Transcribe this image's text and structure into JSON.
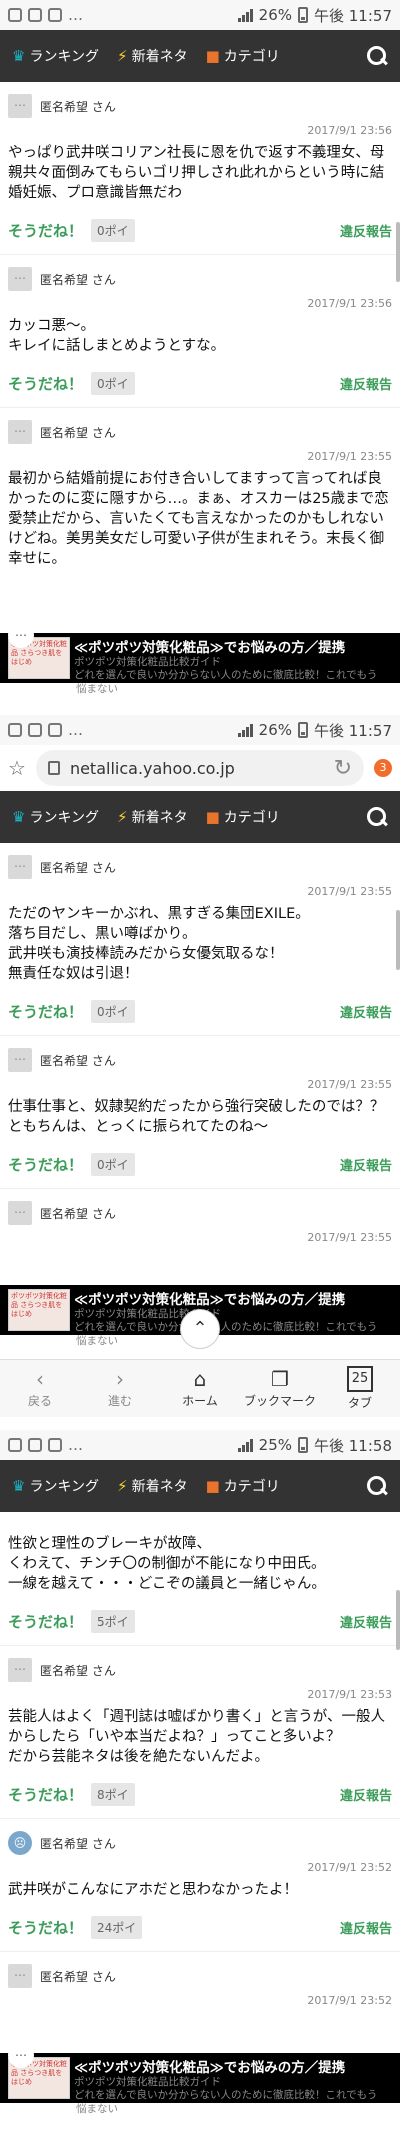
{
  "status": [
    {
      "battery": "26%",
      "time": "午後 11:57"
    },
    {
      "battery": "26%",
      "time": "午後 11:57"
    },
    {
      "battery": "25%",
      "time": "午後 11:58"
    }
  ],
  "nav": {
    "ranking": "ランキング",
    "news": "新着ネタ",
    "category": "カテゴリ"
  },
  "common": {
    "author": "匿名希望 さん",
    "agree": "そうだね！",
    "report": "違反報告"
  },
  "ad": {
    "title": "≪ポツポツ対策化粧品≫でお悩みの方／提携",
    "line1": "ポツポツ対策化粧品比較ガイド",
    "line2": "どれを選んで良いか分からない人のために徹底比較！これでもう",
    "line3": "悩まない",
    "thumb": "ポツポツ対策化粧品 さらつき肌をはじめ"
  },
  "browser": {
    "url": "netallica.yahoo.co.jp",
    "tab_count": "3"
  },
  "toolbar": {
    "back": "戻る",
    "forward": "進む",
    "home": "ホーム",
    "bookmark": "ブックマーク",
    "tabs": "タブ",
    "tabs_count": "25"
  },
  "section1": [
    {
      "date": "2017/9/1 23:56",
      "body": "やっぱり武井咲コリアン社長に恩を仇で返す不義理女、母親共々面倒みてもらいゴリ押しされ此れからという時に結婚妊娠、プロ意識皆無だわ",
      "points": "0ポイ"
    },
    {
      "date": "2017/9/1 23:56",
      "body": "カッコ悪〜。\nキレイに話しまとめようとすな。",
      "points": "0ポイ"
    },
    {
      "date": "2017/9/1 23:55",
      "body": "最初から結婚前提にお付き合いしてますって言ってれば良かったのに変に隠すから…。まぁ、オスカーは25歳まで恋愛禁止だから、言いたくても言えなかったのかもしれないけどね。美男美女だし可愛い子供が生まれそう。末長く御幸せに。"
    }
  ],
  "section2": [
    {
      "date": "2017/9/1 23:55",
      "body": "ただのヤンキーかぶれ、黒すぎる集団EXILE。\n落ち目だし、黒い噂ばかり。\n武井咲も演技棒読みだから女優気取るな！\n無責任な奴は引退！",
      "points": "0ポイ"
    },
    {
      "date": "2017/9/1 23:55",
      "body": "仕事仕事と、奴隷契約だったから強行突破したのでは？？\nともちんは、とっくに振られてたのね〜",
      "points": "0ポイ"
    },
    {
      "date": "2017/9/1 23:55"
    }
  ],
  "section3": [
    {
      "body": "性欲と理性のブレーキが故障、\nくわえて、チンチ〇の制御が不能になり中田氏。\n一線を越えて・・・どこぞの議員と一緒じゃん。",
      "points": "5ポイ"
    },
    {
      "date": "2017/9/1 23:53",
      "body": "芸能人はよく「週刊誌は嘘ばかり書く」と言うが、一般人からしたら「いや本当だよね？」ってこと多いよ？\nだから芸能ネタは後を絶たないんだよ。",
      "points": "8ポイ"
    },
    {
      "date": "2017/9/1 23:52",
      "body": "武井咲がこんなにアホだと思わなかったよ！",
      "points": "24ポイ"
    },
    {
      "date": "2017/9/1 23:52"
    }
  ]
}
